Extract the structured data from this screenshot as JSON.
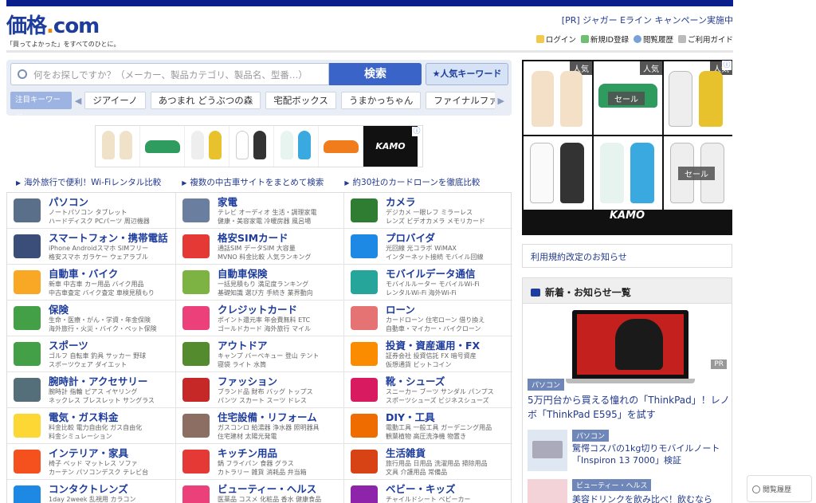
{
  "header": {
    "logo_main": "価格",
    "logo_dot": ".",
    "logo_com": "com",
    "tagline": "「買ってよかった」をすべてのひとに。",
    "pr_text": "[PR] ジャガー Eライン キャンペーン実施中",
    "links": [
      "ログイン",
      "新規ID登録",
      "閲覧履歴",
      "ご利用ガイド"
    ]
  },
  "search": {
    "placeholder": "何をお探しですか？（メーカー、製品カテゴリ、製品名、型番…）",
    "button": "検索",
    "popular": "★人気キーワード",
    "keyword_label": "注目キーワード",
    "keywords": [
      "ジアイーノ",
      "あつまれ どうぶつの森",
      "宅配ボックス",
      "うまかっちゃん",
      "ファイナルファン"
    ]
  },
  "banner": {
    "brand": "KAMO"
  },
  "promo_links": [
    "海外旅行で便利！Wi-Fiレンタル比較",
    "複数の中古車サイトをまとめて検索",
    "約30社のカードローンを徹底比較"
  ],
  "categories": [
    {
      "title": "パソコン",
      "sub1": "ノートパソコン タブレット",
      "sub2": "ハードディスク PCパーツ 周辺機器",
      "color": "#5a6f8a"
    },
    {
      "title": "家電",
      "sub1": "テレビ オーディオ 生活・調理家電",
      "sub2": "健康・美容家電 冷暖房器 風呂場",
      "color": "#6a7fa0"
    },
    {
      "title": "カメラ",
      "sub1": "デジカメ 一眼レフ ミラーレス",
      "sub2": "レンズ ビデオカメラ メモリカード",
      "color": "#2e7d32"
    },
    {
      "title": "スマートフォン・携帯電話",
      "sub1": "iPhone Androidスマホ SIMフリー",
      "sub2": "格安スマホ ガラケー ウェアラブル",
      "color": "#3b4e7a"
    },
    {
      "title": "格安SIMカード",
      "sub1": "通話SIM データSIM 大容量",
      "sub2": "MVNO 料金比較 人気ランキング",
      "color": "#e53935"
    },
    {
      "title": "プロバイダ",
      "sub1": "光回線 光コラボ WiMAX",
      "sub2": "インターネット接続 モバイル回線",
      "color": "#1e88e5"
    },
    {
      "title": "自動車・バイク",
      "sub1": "新車 中古車 カー用品 バイク用品",
      "sub2": "中古車査定 バイク査定 車検見積もり",
      "color": "#f9a825"
    },
    {
      "title": "自動車保険",
      "sub1": "一括見積もり 満足度ランキング",
      "sub2": "基礎知識 選び方 手続き 業界動向",
      "color": "#7cb342"
    },
    {
      "title": "モバイルデータ通信",
      "sub1": "モバイルルーター モバイルWi-Fi",
      "sub2": "レンタルWi-Fi 海外Wi-Fi",
      "color": "#26a69a"
    },
    {
      "title": "保険",
      "sub1": "生命・医療・がん・学資・年金保険",
      "sub2": "海外旅行・火災・バイク・ペット保険",
      "color": "#43a047"
    },
    {
      "title": "クレジットカード",
      "sub1": "ポイント還元率 年会費無料 ETC",
      "sub2": "ゴールドカード 海外旅行 マイル",
      "color": "#ec407a"
    },
    {
      "title": "ローン",
      "sub1": "カードローン 住宅ローン 借り換え",
      "sub2": "自動車・マイカー・バイクローン",
      "color": "#e57373"
    },
    {
      "title": "スポーツ",
      "sub1": "ゴルフ 自転車 釣具 サッカー 野球",
      "sub2": "スポーツウェア ダイエット",
      "color": "#43a047"
    },
    {
      "title": "アウトドア",
      "sub1": "キャンプ バーベキュー 登山 テント",
      "sub2": "寝袋 ライト 水筒",
      "color": "#558b2f"
    },
    {
      "title": "投資・資産運用・FX",
      "sub1": "証券会社 投資信託 FX 暗号資産",
      "sub2": "仮想通貨 ビットコイン",
      "color": "#fb8c00"
    },
    {
      "title": "腕時計・アクセサリー",
      "sub1": "腕時計 指輪 ピアス イヤリング",
      "sub2": "ネックレス ブレスレット サングラス",
      "color": "#546e7a"
    },
    {
      "title": "ファッション",
      "sub1": "ブランド品 財布 バッグ トップス",
      "sub2": "パンツ スカート スーツ ドレス",
      "color": "#c62828"
    },
    {
      "title": "靴・シューズ",
      "sub1": "スニーカー ブーツ サンダル パンプス",
      "sub2": "スポーツシューズ ビジネスシューズ",
      "color": "#d81b60"
    },
    {
      "title": "電気・ガス料金",
      "sub1": "料金比較 電力自由化 ガス自由化",
      "sub2": "料金シミュレーション",
      "color": "#fdd835"
    },
    {
      "title": "住宅設備・リフォーム",
      "sub1": "ガスコンロ 給湯器 浄水器 照明器具",
      "sub2": "住宅建材 太陽光発電",
      "color": "#8d6e63"
    },
    {
      "title": "DIY・工具",
      "sub1": "電動工具 一般工具 ガーデニング用品",
      "sub2": "観葉植物 高圧洗浄機 物置き",
      "color": "#ef6c00"
    },
    {
      "title": "インテリア・家具",
      "sub1": "椅子 ベッド マットレス ソファ",
      "sub2": "カーテン パソコンデスク テレビ台",
      "color": "#f4511e"
    },
    {
      "title": "キッチン用品",
      "sub1": "鍋 フライパン 食器 グラス",
      "sub2": "カトラリー 雑貨 消耗品 弁当箱",
      "color": "#e53935"
    },
    {
      "title": "生活雑貨",
      "sub1": "旅行用品 日用品 洗濯用品 掃除用品",
      "sub2": "文具 介護用品 常備品",
      "color": "#d84315"
    },
    {
      "title": "コンタクトレンズ",
      "sub1": "1day 2week 乱視用 カラコン",
      "sub2": "",
      "color": "#1e88e5"
    },
    {
      "title": "ビューティー・ヘルス",
      "sub1": "医薬品 コスメ 化粧品 香水 健康食品",
      "sub2": "",
      "color": "#ec407a"
    },
    {
      "title": "ベビー・キッズ",
      "sub1": "チャイルドシート ベビーカー",
      "sub2": "",
      "color": "#8e24aa"
    }
  ],
  "side_ad": {
    "popular_label": "人気",
    "sale_label": "セール",
    "brand": "KAMO"
  },
  "notice": "利用規約改定のお知らせ",
  "news": {
    "header": "新着・お知らせ一覧",
    "pr": "PR",
    "item1_tag": "パソコン",
    "item1_title": "5万円台から買える憧れの「ThinkPad」！レノボ「ThinkPad E595」を試す",
    "item2_tag": "パソコン",
    "item2_title": "驚愕コスパの1kg切りモバイルノート「Inspiron 13 7000」検証",
    "item3_tag": "ビューティー・ヘルス",
    "item3_title": "美容ドリンクを飲み比べ！飲むなら"
  },
  "history_button": "閲覧履歴"
}
